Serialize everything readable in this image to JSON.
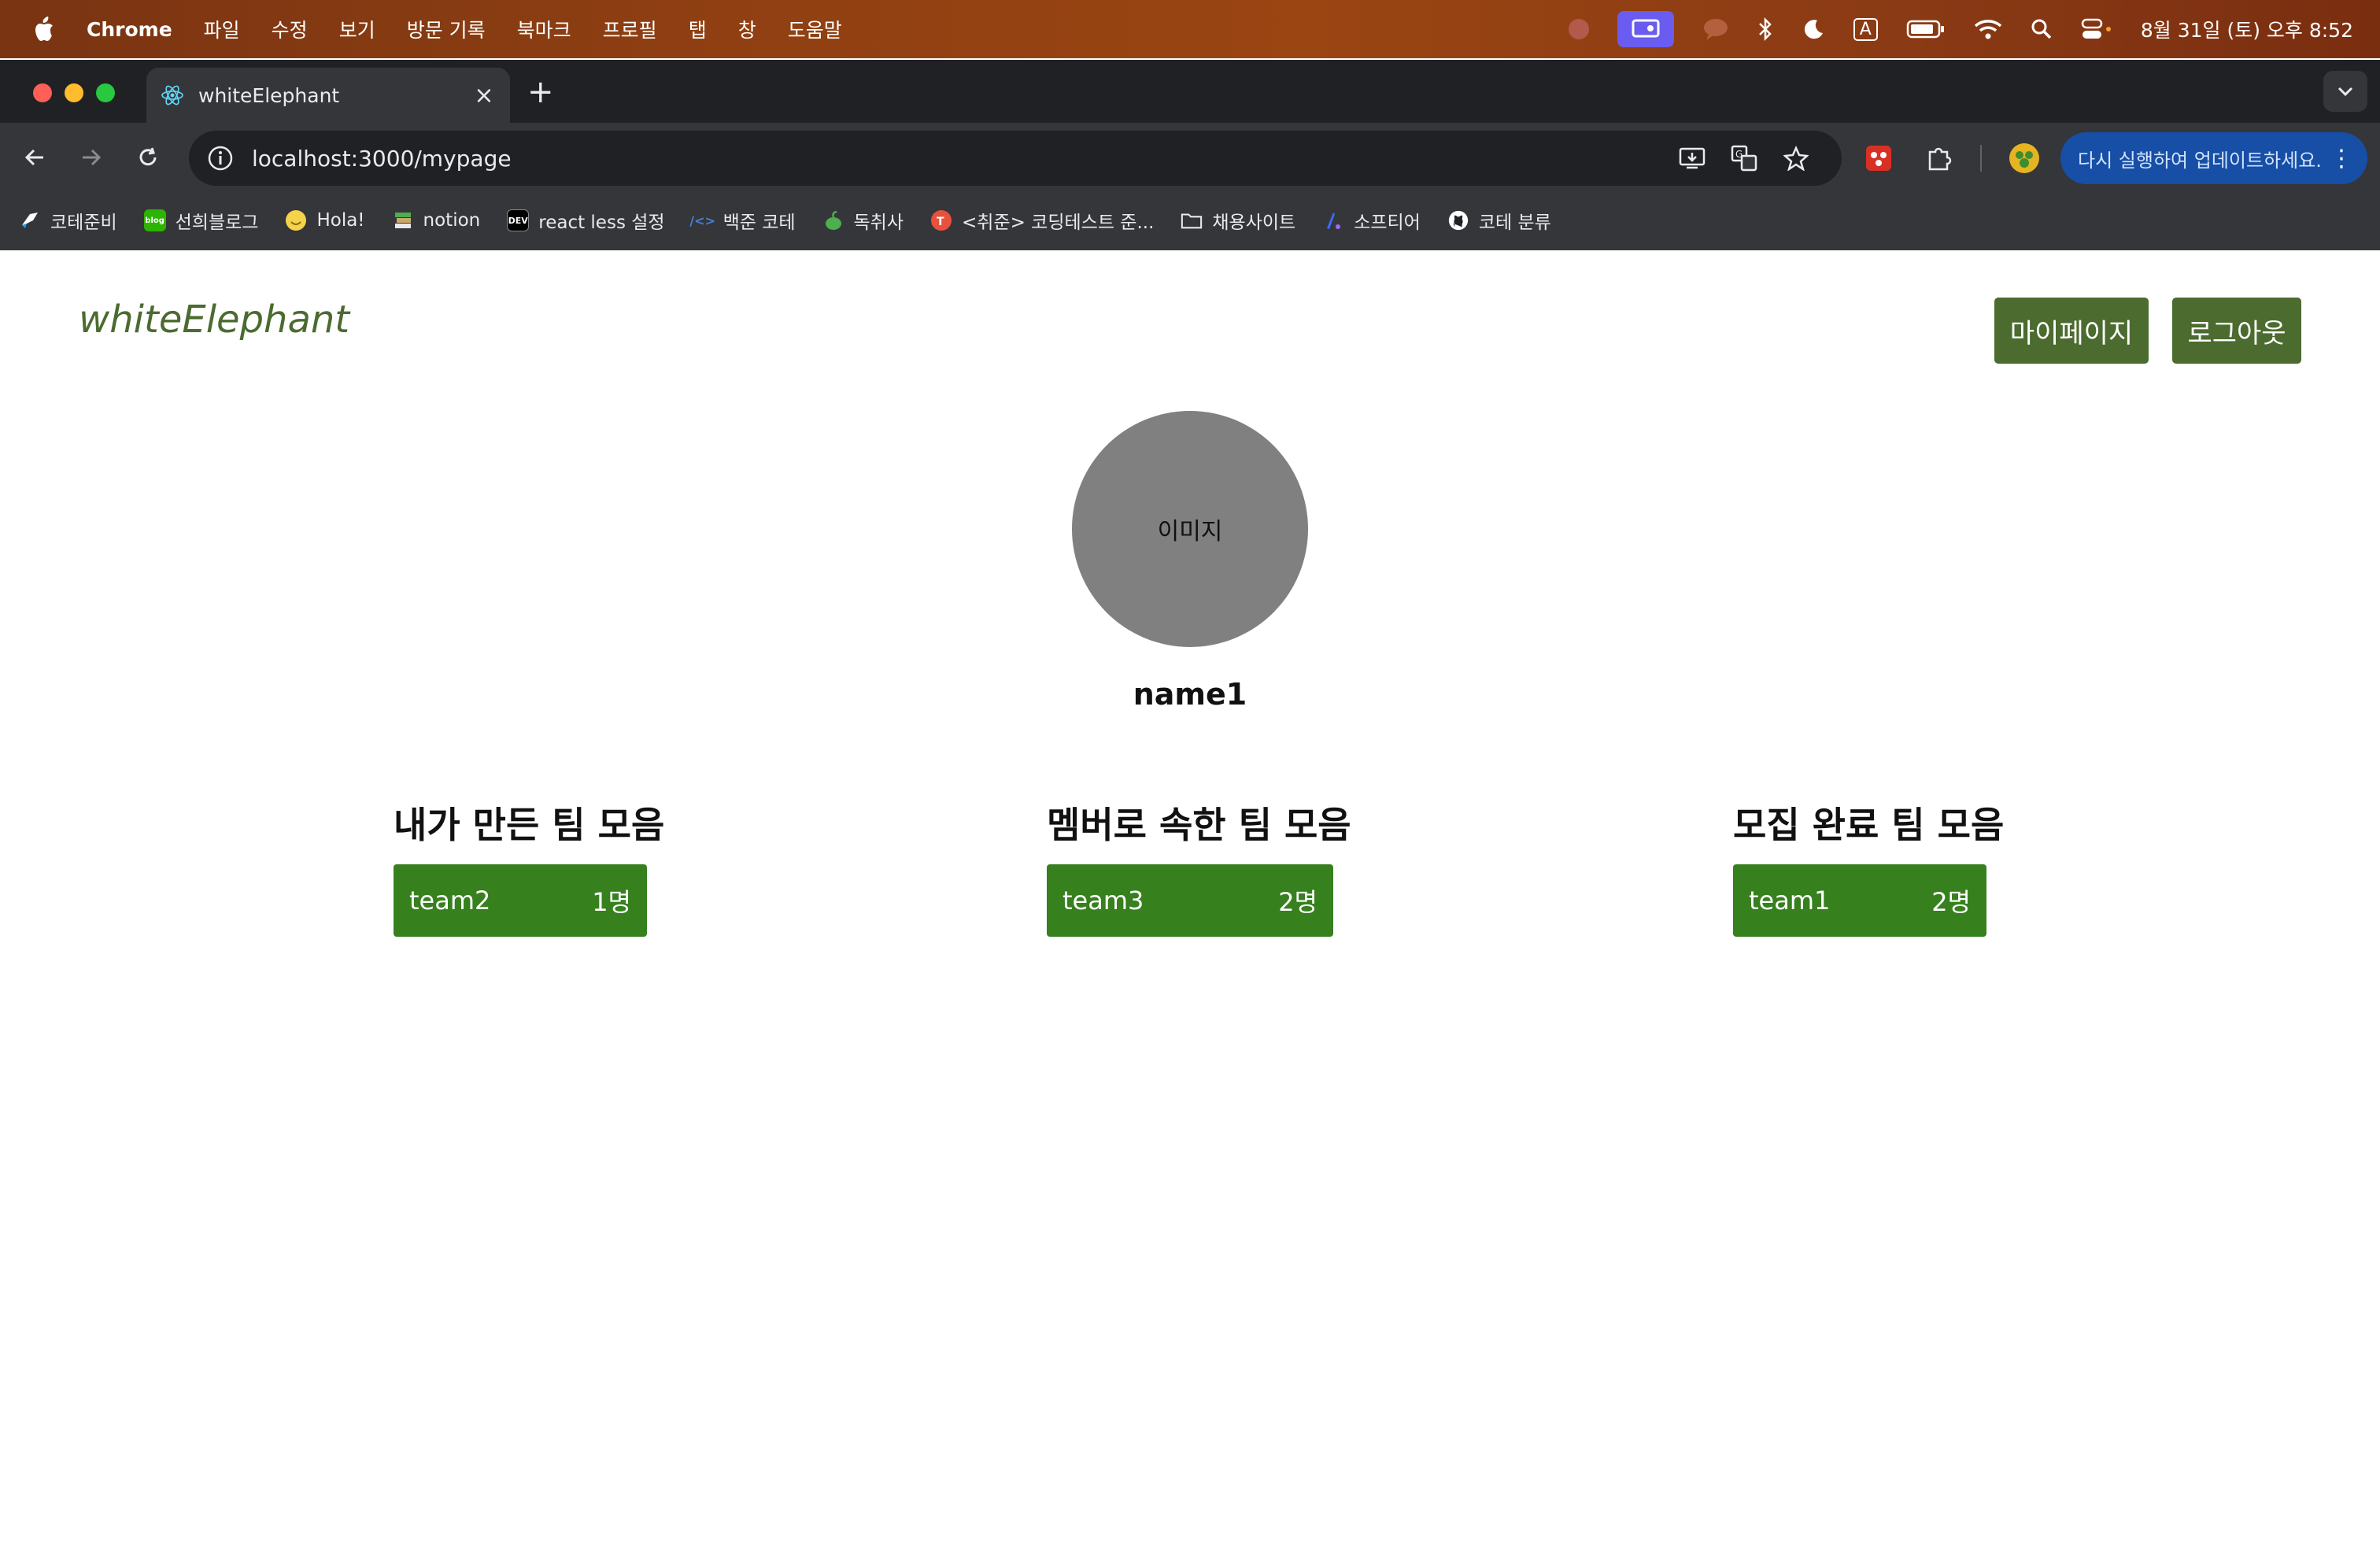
{
  "menubar": {
    "app": "Chrome",
    "items": [
      "파일",
      "수정",
      "보기",
      "방문 기록",
      "북마크",
      "프로필",
      "탭",
      "창",
      "도움말"
    ],
    "clock": "8월 31일 (토) 오후 8:52",
    "input_indicator": "A"
  },
  "browser": {
    "tab_title": "whiteElephant",
    "tab_close": "×",
    "new_tab": "+",
    "url": "localhost:3000/mypage",
    "update_label": "다시 실행하여 업데이트하세요.",
    "update_menu": "⋮",
    "bookmarks": [
      {
        "label": "코테준비",
        "icon_text": "",
        "color": "#1da1f2"
      },
      {
        "label": "선희블로그",
        "icon_text": "blog",
        "color": "#2db400"
      },
      {
        "label": "Hola!",
        "icon_text": "",
        "color": "#f5d34b"
      },
      {
        "label": "notion",
        "icon_text": "",
        "color": "#c9a86a"
      },
      {
        "label": "react less 설정",
        "icon_text": "DEV",
        "color": "#000000"
      },
      {
        "label": "백준 코테",
        "icon_text": "/<>",
        "color": "#35363a"
      },
      {
        "label": "독취사",
        "icon_text": "",
        "color": "#4caf50"
      },
      {
        "label": "<취준> 코딩테스트 준...",
        "icon_text": "",
        "color": "#e8513c"
      },
      {
        "label": "채용사이트",
        "icon_text": "",
        "color": "#35363a"
      },
      {
        "label": "소프티어",
        "icon_text": "",
        "color": "#3d6bff"
      },
      {
        "label": "코테 분류",
        "icon_text": "",
        "color": "#ffffff"
      }
    ]
  },
  "page": {
    "logo": "whiteElephant",
    "buttons": {
      "mypage": "마이페이지",
      "logout": "로그아웃"
    },
    "profile": {
      "image_placeholder": "이미지",
      "name": "name1"
    },
    "sections": [
      {
        "title": "내가 만든 팀 모음",
        "team": "team2",
        "count": "1명"
      },
      {
        "title": "멤버로 속한 팀 모음",
        "team": "team3",
        "count": "2명"
      },
      {
        "title": "모집 완료 팀 모음",
        "team": "team1",
        "count": "2명"
      }
    ]
  },
  "colors": {
    "brand": "#4b6b2f",
    "team_card": "#36801e",
    "avatar": "#808080"
  }
}
